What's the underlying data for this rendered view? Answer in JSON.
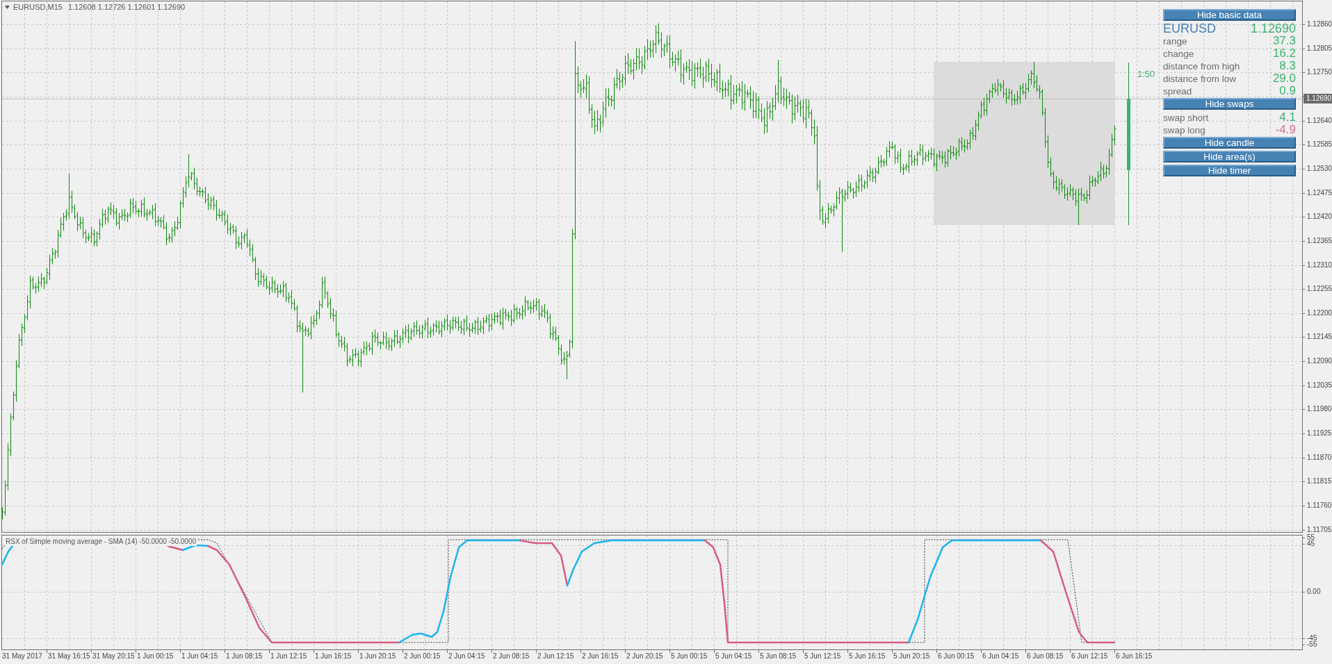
{
  "header": {
    "symbol": "EURUSD,M15",
    "quotes": "1.12608 1.12726 1.12601 1.12690"
  },
  "timer": "1:50",
  "panel": {
    "items": [
      {
        "kind": "button",
        "label": "Hide basic data"
      },
      {
        "kind": "symbol",
        "label": "EURUSD",
        "value": "1.12690",
        "color": "#3cb371"
      },
      {
        "kind": "stat",
        "label": "range",
        "value": "37.3",
        "color": "#3cb371"
      },
      {
        "kind": "stat",
        "label": "change",
        "value": "16.2",
        "color": "#3cb371"
      },
      {
        "kind": "stat",
        "label": "distance from high",
        "value": "8.3",
        "color": "#3cb371"
      },
      {
        "kind": "stat",
        "label": "distance from low",
        "value": "29.0",
        "color": "#3cb371"
      },
      {
        "kind": "stat",
        "label": "spread",
        "value": "0.9",
        "color": "#3cb371"
      },
      {
        "kind": "button",
        "label": "Hide swaps"
      },
      {
        "kind": "stat",
        "label": "swap short",
        "value": "4.1",
        "color": "#3cb371"
      },
      {
        "kind": "stat",
        "label": "swap long",
        "value": "-4.9",
        "color": "#db7093"
      },
      {
        "kind": "button",
        "label": "Hide candle"
      },
      {
        "kind": "button",
        "label": "Hide area(s)"
      },
      {
        "kind": "button",
        "label": "Hide timer"
      }
    ]
  },
  "price_axis": {
    "labels": [
      "1.12860",
      "1.12805",
      "1.12750",
      "1.12640",
      "1.12585",
      "1.12530",
      "1.12475",
      "1.12420",
      "1.12365",
      "1.12310",
      "1.12255",
      "1.12200",
      "1.12145",
      "1.12090",
      "1.12035",
      "1.11980",
      "1.11925",
      "1.11870",
      "1.11815",
      "1.11760",
      "1.11705"
    ],
    "current_price": "1.12690"
  },
  "indicator": {
    "title": "RSX of Simple moving average - SMA (14) -50.0000 -50.0000",
    "levels": [
      "55",
      "45",
      "0.00",
      "-45",
      "-55"
    ]
  },
  "time_axis": {
    "labels": [
      "31 May 2017",
      "31 May 16:15",
      "31 May 20:15",
      "1 Jun 00:15",
      "1 Jun 04:15",
      "1 Jun 08:15",
      "1 Jun 12:15",
      "1 Jun 16:15",
      "1 Jun 20:15",
      "2 Jun 00:15",
      "2 Jun 04:15",
      "2 Jun 08:15",
      "2 Jun 12:15",
      "2 Jun 16:15",
      "2 Jun 20:15",
      "5 Jun 00:15",
      "5 Jun 04:15",
      "5 Jun 08:15",
      "5 Jun 12:15",
      "5 Jun 16:15",
      "5 Jun 20:15",
      "6 Jun 00:15",
      "6 Jun 04:15",
      "6 Jun 08:15",
      "6 Jun 12:15",
      "6 Jun 16:15"
    ]
  }
}
